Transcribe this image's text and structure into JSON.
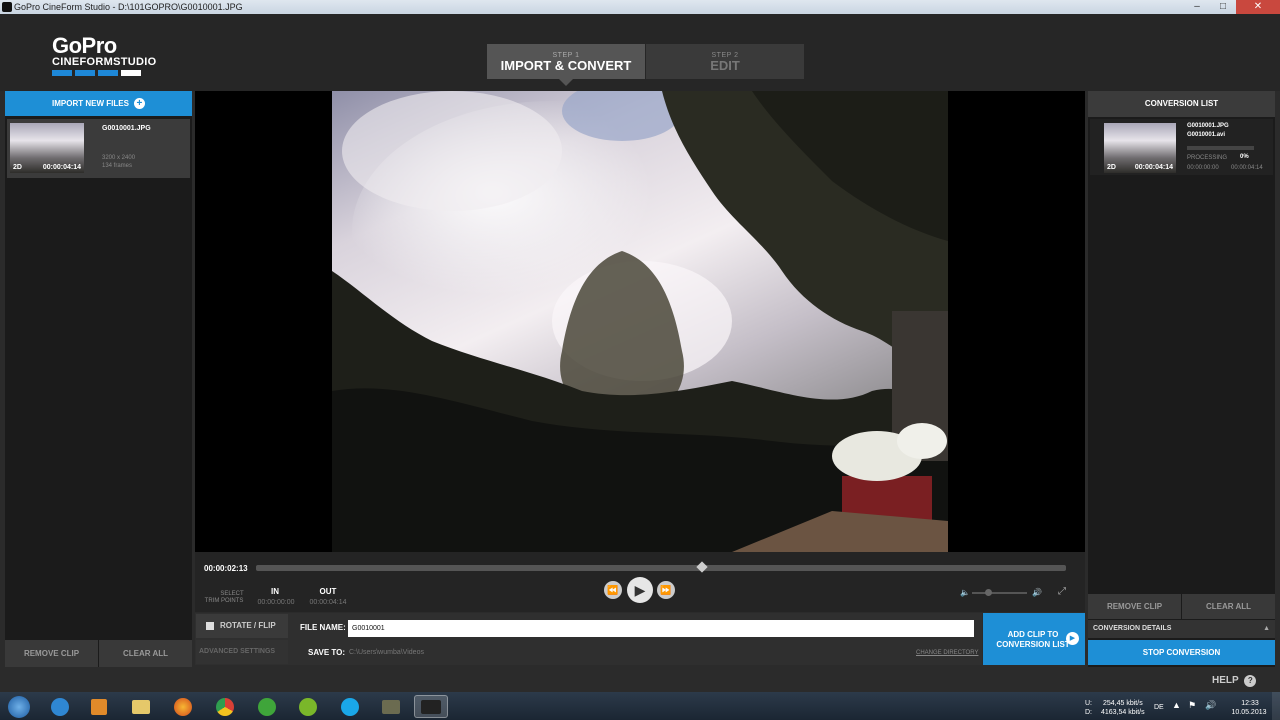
{
  "window": {
    "title": "GoPro CineForm Studio - D:\\101GOPRO\\G0010001.JPG"
  },
  "logo": {
    "line1": "GoPro",
    "line2": "CINEFORMSTUDIO"
  },
  "steps": [
    {
      "num": "STEP 1",
      "label": "IMPORT & CONVERT"
    },
    {
      "num": "STEP 2",
      "label": "EDIT"
    }
  ],
  "left": {
    "import_label": "IMPORT NEW FILES",
    "clip": {
      "name": "G0010001.JPG",
      "resolution": "3200 x 2400",
      "frames": "134 frames",
      "mode": "2D",
      "duration": "00:00:04:14"
    },
    "remove_clip": "REMOVE CLIP",
    "clear_all": "CLEAR ALL"
  },
  "transport": {
    "current_time": "00:00:02:13",
    "progress": 0.55,
    "select": "SELECT",
    "trim_points": "TRIM POINTS",
    "in_label": "IN",
    "in_value": "00:00:00:00",
    "out_label": "OUT",
    "out_value": "00:00:04:14"
  },
  "settings": {
    "rotate_label": "ROTATE / FLIP",
    "advanced_label": "ADVANCED SETTINGS",
    "file_name_label": "FILE NAME:",
    "file_name_value": "G0010001",
    "save_to_label": "SAVE TO:",
    "save_to_value": "C:\\Users\\wumba\\Videos",
    "change_dir": "CHANGE DIRECTORY",
    "add_clip_line1": "ADD CLIP TO",
    "add_clip_line2": "CONVERSION LIST"
  },
  "right": {
    "header": "CONVERSION LIST",
    "clip": {
      "name_src": "G0010001.JPG",
      "name_dst": "G0010001.avi",
      "status": "PROCESSING",
      "percent": "0%",
      "mode": "2D",
      "duration": "00:00:04:14",
      "elapsed": "00:00:00:00",
      "total": "00:00:04:14"
    },
    "remove_clip": "REMOVE CLIP",
    "clear_all": "CLEAR ALL",
    "details": "CONVERSION DETAILS",
    "stop": "STOP CONVERSION"
  },
  "help": "HELP",
  "taskbar": {
    "net_up": "U:",
    "net_up_val": "254,45 kbit/s",
    "net_down": "D:",
    "net_down_val": "4163,54 kbit/s",
    "lang": "DE",
    "time": "12:33",
    "date": "10.05.2013"
  },
  "colors": {
    "accent": "#1e8fd6",
    "bg": "#2b2b2b"
  }
}
